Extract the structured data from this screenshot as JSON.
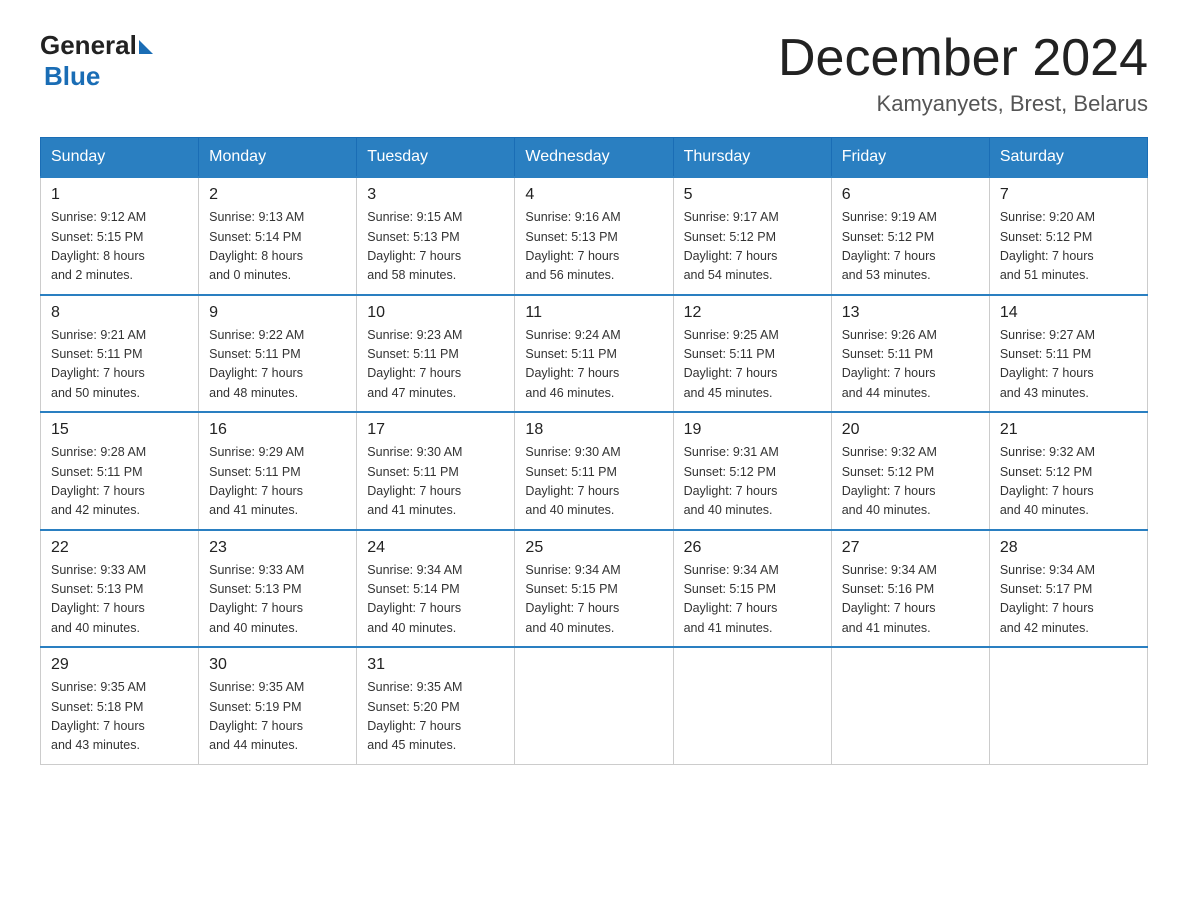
{
  "header": {
    "logo_general": "General",
    "logo_blue": "Blue",
    "month_title": "December 2024",
    "location": "Kamyanyets, Brest, Belarus"
  },
  "days_of_week": [
    "Sunday",
    "Monday",
    "Tuesday",
    "Wednesday",
    "Thursday",
    "Friday",
    "Saturday"
  ],
  "weeks": [
    [
      {
        "day": "1",
        "sunrise": "Sunrise: 9:12 AM",
        "sunset": "Sunset: 5:15 PM",
        "daylight": "Daylight: 8 hours",
        "daylight2": "and 2 minutes."
      },
      {
        "day": "2",
        "sunrise": "Sunrise: 9:13 AM",
        "sunset": "Sunset: 5:14 PM",
        "daylight": "Daylight: 8 hours",
        "daylight2": "and 0 minutes."
      },
      {
        "day": "3",
        "sunrise": "Sunrise: 9:15 AM",
        "sunset": "Sunset: 5:13 PM",
        "daylight": "Daylight: 7 hours",
        "daylight2": "and 58 minutes."
      },
      {
        "day": "4",
        "sunrise": "Sunrise: 9:16 AM",
        "sunset": "Sunset: 5:13 PM",
        "daylight": "Daylight: 7 hours",
        "daylight2": "and 56 minutes."
      },
      {
        "day": "5",
        "sunrise": "Sunrise: 9:17 AM",
        "sunset": "Sunset: 5:12 PM",
        "daylight": "Daylight: 7 hours",
        "daylight2": "and 54 minutes."
      },
      {
        "day": "6",
        "sunrise": "Sunrise: 9:19 AM",
        "sunset": "Sunset: 5:12 PM",
        "daylight": "Daylight: 7 hours",
        "daylight2": "and 53 minutes."
      },
      {
        "day": "7",
        "sunrise": "Sunrise: 9:20 AM",
        "sunset": "Sunset: 5:12 PM",
        "daylight": "Daylight: 7 hours",
        "daylight2": "and 51 minutes."
      }
    ],
    [
      {
        "day": "8",
        "sunrise": "Sunrise: 9:21 AM",
        "sunset": "Sunset: 5:11 PM",
        "daylight": "Daylight: 7 hours",
        "daylight2": "and 50 minutes."
      },
      {
        "day": "9",
        "sunrise": "Sunrise: 9:22 AM",
        "sunset": "Sunset: 5:11 PM",
        "daylight": "Daylight: 7 hours",
        "daylight2": "and 48 minutes."
      },
      {
        "day": "10",
        "sunrise": "Sunrise: 9:23 AM",
        "sunset": "Sunset: 5:11 PM",
        "daylight": "Daylight: 7 hours",
        "daylight2": "and 47 minutes."
      },
      {
        "day": "11",
        "sunrise": "Sunrise: 9:24 AM",
        "sunset": "Sunset: 5:11 PM",
        "daylight": "Daylight: 7 hours",
        "daylight2": "and 46 minutes."
      },
      {
        "day": "12",
        "sunrise": "Sunrise: 9:25 AM",
        "sunset": "Sunset: 5:11 PM",
        "daylight": "Daylight: 7 hours",
        "daylight2": "and 45 minutes."
      },
      {
        "day": "13",
        "sunrise": "Sunrise: 9:26 AM",
        "sunset": "Sunset: 5:11 PM",
        "daylight": "Daylight: 7 hours",
        "daylight2": "and 44 minutes."
      },
      {
        "day": "14",
        "sunrise": "Sunrise: 9:27 AM",
        "sunset": "Sunset: 5:11 PM",
        "daylight": "Daylight: 7 hours",
        "daylight2": "and 43 minutes."
      }
    ],
    [
      {
        "day": "15",
        "sunrise": "Sunrise: 9:28 AM",
        "sunset": "Sunset: 5:11 PM",
        "daylight": "Daylight: 7 hours",
        "daylight2": "and 42 minutes."
      },
      {
        "day": "16",
        "sunrise": "Sunrise: 9:29 AM",
        "sunset": "Sunset: 5:11 PM",
        "daylight": "Daylight: 7 hours",
        "daylight2": "and 41 minutes."
      },
      {
        "day": "17",
        "sunrise": "Sunrise: 9:30 AM",
        "sunset": "Sunset: 5:11 PM",
        "daylight": "Daylight: 7 hours",
        "daylight2": "and 41 minutes."
      },
      {
        "day": "18",
        "sunrise": "Sunrise: 9:30 AM",
        "sunset": "Sunset: 5:11 PM",
        "daylight": "Daylight: 7 hours",
        "daylight2": "and 40 minutes."
      },
      {
        "day": "19",
        "sunrise": "Sunrise: 9:31 AM",
        "sunset": "Sunset: 5:12 PM",
        "daylight": "Daylight: 7 hours",
        "daylight2": "and 40 minutes."
      },
      {
        "day": "20",
        "sunrise": "Sunrise: 9:32 AM",
        "sunset": "Sunset: 5:12 PM",
        "daylight": "Daylight: 7 hours",
        "daylight2": "and 40 minutes."
      },
      {
        "day": "21",
        "sunrise": "Sunrise: 9:32 AM",
        "sunset": "Sunset: 5:12 PM",
        "daylight": "Daylight: 7 hours",
        "daylight2": "and 40 minutes."
      }
    ],
    [
      {
        "day": "22",
        "sunrise": "Sunrise: 9:33 AM",
        "sunset": "Sunset: 5:13 PM",
        "daylight": "Daylight: 7 hours",
        "daylight2": "and 40 minutes."
      },
      {
        "day": "23",
        "sunrise": "Sunrise: 9:33 AM",
        "sunset": "Sunset: 5:13 PM",
        "daylight": "Daylight: 7 hours",
        "daylight2": "and 40 minutes."
      },
      {
        "day": "24",
        "sunrise": "Sunrise: 9:34 AM",
        "sunset": "Sunset: 5:14 PM",
        "daylight": "Daylight: 7 hours",
        "daylight2": "and 40 minutes."
      },
      {
        "day": "25",
        "sunrise": "Sunrise: 9:34 AM",
        "sunset": "Sunset: 5:15 PM",
        "daylight": "Daylight: 7 hours",
        "daylight2": "and 40 minutes."
      },
      {
        "day": "26",
        "sunrise": "Sunrise: 9:34 AM",
        "sunset": "Sunset: 5:15 PM",
        "daylight": "Daylight: 7 hours",
        "daylight2": "and 41 minutes."
      },
      {
        "day": "27",
        "sunrise": "Sunrise: 9:34 AM",
        "sunset": "Sunset: 5:16 PM",
        "daylight": "Daylight: 7 hours",
        "daylight2": "and 41 minutes."
      },
      {
        "day": "28",
        "sunrise": "Sunrise: 9:34 AM",
        "sunset": "Sunset: 5:17 PM",
        "daylight": "Daylight: 7 hours",
        "daylight2": "and 42 minutes."
      }
    ],
    [
      {
        "day": "29",
        "sunrise": "Sunrise: 9:35 AM",
        "sunset": "Sunset: 5:18 PM",
        "daylight": "Daylight: 7 hours",
        "daylight2": "and 43 minutes."
      },
      {
        "day": "30",
        "sunrise": "Sunrise: 9:35 AM",
        "sunset": "Sunset: 5:19 PM",
        "daylight": "Daylight: 7 hours",
        "daylight2": "and 44 minutes."
      },
      {
        "day": "31",
        "sunrise": "Sunrise: 9:35 AM",
        "sunset": "Sunset: 5:20 PM",
        "daylight": "Daylight: 7 hours",
        "daylight2": "and 45 minutes."
      },
      null,
      null,
      null,
      null
    ]
  ]
}
